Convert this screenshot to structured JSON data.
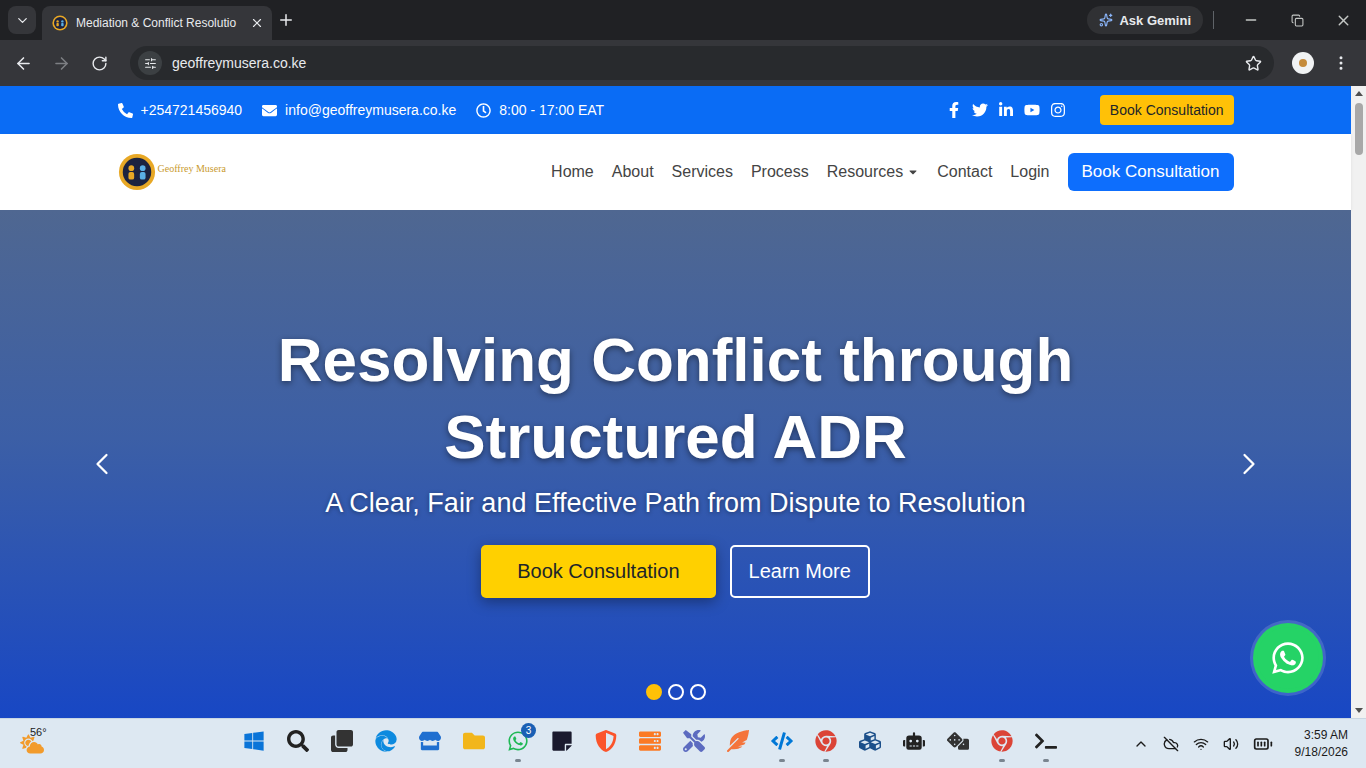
{
  "browser": {
    "tab_title": "Mediation & Conflict Resolutio",
    "url": "geoffreymusera.co.ke",
    "gemini": "Ask Gemini"
  },
  "topbar": {
    "contacts": [
      {
        "kind": "phone",
        "text": "+254721456940"
      },
      {
        "kind": "email",
        "text": "info@geoffreymusera.co.ke"
      },
      {
        "kind": "clock",
        "text": "8:00 - 17:00 EAT"
      }
    ],
    "social": [
      {
        "kind": "facebook"
      },
      {
        "kind": "twitter"
      },
      {
        "kind": "linkedin"
      },
      {
        "kind": "youtube"
      },
      {
        "kind": "instagram"
      }
    ],
    "button": "Book Consultation"
  },
  "navbar": {
    "logo_text": "Geoffrey Musera",
    "items": [
      {
        "label": "Home",
        "dropdown": false
      },
      {
        "label": "About",
        "dropdown": false
      },
      {
        "label": "Services",
        "dropdown": false
      },
      {
        "label": "Process",
        "dropdown": false
      },
      {
        "label": "Resources",
        "dropdown": true
      },
      {
        "label": "Contact",
        "dropdown": false
      },
      {
        "label": "Login",
        "dropdown": false
      }
    ],
    "button": "Book Consultation"
  },
  "hero": {
    "title": "Resolving Conflict through Structured ADR",
    "subtitle": "A Clear, Fair and Effective Path from Dispute to Resolution",
    "buttons": [
      {
        "label": "Book Consultation",
        "kind": "primary"
      },
      {
        "label": "Learn More",
        "kind": "outline"
      }
    ],
    "indicators": [
      {
        "selected": true
      },
      {
        "selected": false
      },
      {
        "selected": false
      }
    ]
  },
  "taskbar": {
    "weather": "56°",
    "apps": [
      {
        "kind": "start",
        "running": false
      },
      {
        "kind": "search",
        "running": false
      },
      {
        "kind": "taskview",
        "running": false
      },
      {
        "kind": "edge",
        "running": false
      },
      {
        "kind": "store",
        "running": false
      },
      {
        "kind": "explorer",
        "running": false
      },
      {
        "kind": "whatsapp",
        "running": true,
        "badge": "3"
      },
      {
        "kind": "notion",
        "running": false
      },
      {
        "kind": "brave",
        "running": false
      },
      {
        "kind": "xampp",
        "running": false
      },
      {
        "kind": "tool",
        "running": false
      },
      {
        "kind": "paint",
        "running": false
      },
      {
        "kind": "vscode",
        "running": true
      },
      {
        "kind": "chrome",
        "running": true
      },
      {
        "kind": "app",
        "running": false
      },
      {
        "kind": "robot",
        "running": false
      },
      {
        "kind": "cards",
        "running": false
      },
      {
        "kind": "chrome",
        "running": true
      },
      {
        "kind": "terminal",
        "running": true
      }
    ],
    "time": "3:59 AM",
    "date": "9/18/2026"
  }
}
